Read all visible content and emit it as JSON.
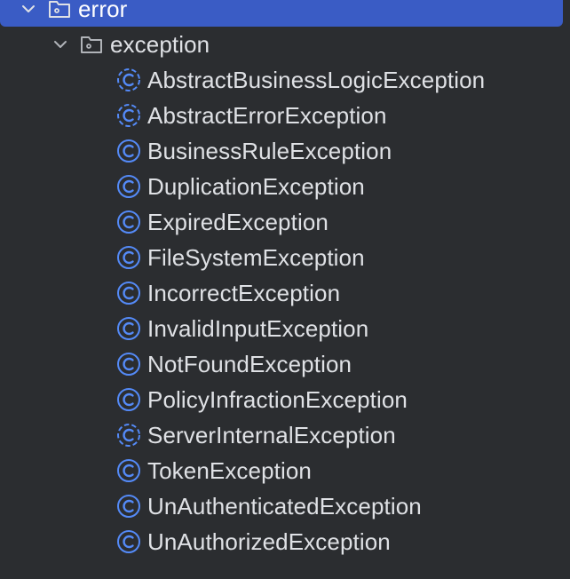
{
  "tree": {
    "error_folder": {
      "label": "error",
      "expanded": true,
      "selected": true
    },
    "exception_folder": {
      "label": "exception",
      "expanded": true
    },
    "classes": [
      {
        "label": "AbstractBusinessLogicException",
        "icon": "abstract-class-icon"
      },
      {
        "label": "AbstractErrorException",
        "icon": "abstract-class-icon"
      },
      {
        "label": "BusinessRuleException",
        "icon": "class-icon"
      },
      {
        "label": "DuplicationException",
        "icon": "class-icon"
      },
      {
        "label": "ExpiredException",
        "icon": "class-icon"
      },
      {
        "label": "FileSystemException",
        "icon": "class-icon"
      },
      {
        "label": "IncorrectException",
        "icon": "class-icon"
      },
      {
        "label": "InvalidInputException",
        "icon": "class-icon"
      },
      {
        "label": "NotFoundException",
        "icon": "class-icon"
      },
      {
        "label": "PolicyInfractionException",
        "icon": "class-icon"
      },
      {
        "label": "ServerInternalException",
        "icon": "abstract-class-icon"
      },
      {
        "label": "TokenException",
        "icon": "class-icon"
      },
      {
        "label": "UnAuthenticatedException",
        "icon": "class-icon"
      },
      {
        "label": "UnAuthorizedException",
        "icon": "class-icon"
      }
    ]
  },
  "colors": {
    "background": "#2b2d30",
    "selection": "#3a5cc5",
    "class_icon": "#548af7",
    "text": "#dfe1e5"
  }
}
